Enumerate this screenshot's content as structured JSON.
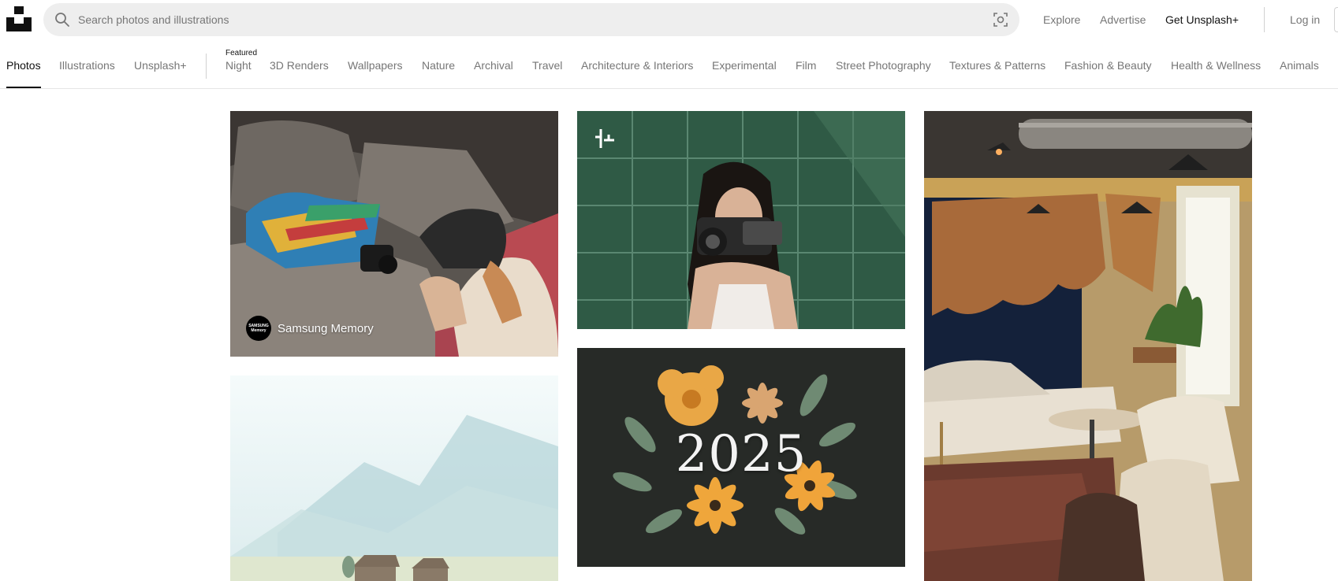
{
  "header": {
    "search_placeholder": "Search photos and illustrations",
    "nav": {
      "explore": "Explore",
      "advertise": "Advertise",
      "get_plus": "Get Unsplash+",
      "login": "Log in"
    }
  },
  "categories": {
    "primary": [
      "Photos",
      "Illustrations",
      "Unsplash+"
    ],
    "featured_label": "Featured",
    "topics": [
      "Night",
      "3D Renders",
      "Wallpapers",
      "Nature",
      "Archival",
      "Travel",
      "Architecture & Interiors",
      "Experimental",
      "Film",
      "Street Photography",
      "Textures & Patterns",
      "Fashion & Beauty",
      "Health & Wellness",
      "Animals"
    ]
  },
  "photos": {
    "tile1": {
      "sponsor_name": "Samsung Memory",
      "avatar_line1": "SAMSUNG",
      "avatar_line2": "Memory"
    },
    "tile4": {
      "text": "2025"
    }
  },
  "colors": {
    "accent": "#111111",
    "muted_text": "#767676",
    "search_bg": "#eeeeee"
  },
  "icons": {
    "logo": "unsplash-logo-icon",
    "search": "search-icon",
    "visual_search": "visual-search-icon",
    "plus_badge": "unsplash-plus-icon"
  }
}
